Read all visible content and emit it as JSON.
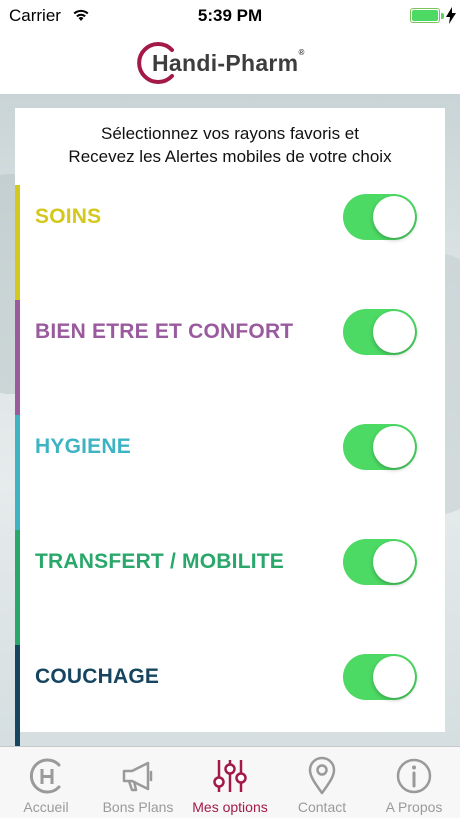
{
  "status_bar": {
    "carrier": "Carrier",
    "time": "5:39 PM",
    "icons": [
      "wifi-icon",
      "battery-icon",
      "charging-bolt-icon"
    ]
  },
  "header": {
    "logo_text": "Handi-Pharm",
    "logo_mark_icon": "handi-pharm-logo-icon",
    "brand_color": "#a31a4a"
  },
  "card": {
    "intro_line1": "Sélectionnez vos rayons favoris et",
    "intro_line2": "Recevez les Alertes mobiles de votre choix",
    "options": [
      {
        "label": "SOINS",
        "color": "#d4c81c",
        "enabled": true
      },
      {
        "label": "BIEN ETRE ET CONFORT",
        "color": "#9a5b9e",
        "enabled": true
      },
      {
        "label": "HYGIENE",
        "color": "#3db3c3",
        "enabled": true
      },
      {
        "label": "TRANSFERT / MOBILITE",
        "color": "#2aa86b",
        "enabled": true
      },
      {
        "label": "COUCHAGE",
        "color": "#164560",
        "enabled": true
      }
    ],
    "toggle_on_color": "#4cd964"
  },
  "tab_bar": {
    "active_color": "#a31a4a",
    "inactive_color": "#9a9a9a",
    "tabs": [
      {
        "label": "Accueil",
        "icon": "home-h-icon",
        "active": false
      },
      {
        "label": "Bons Plans",
        "icon": "megaphone-icon",
        "active": false
      },
      {
        "label": "Mes options",
        "icon": "sliders-icon",
        "active": true
      },
      {
        "label": "Contact",
        "icon": "map-pin-icon",
        "active": false
      },
      {
        "label": "A Propos",
        "icon": "info-icon",
        "active": false
      }
    ]
  }
}
